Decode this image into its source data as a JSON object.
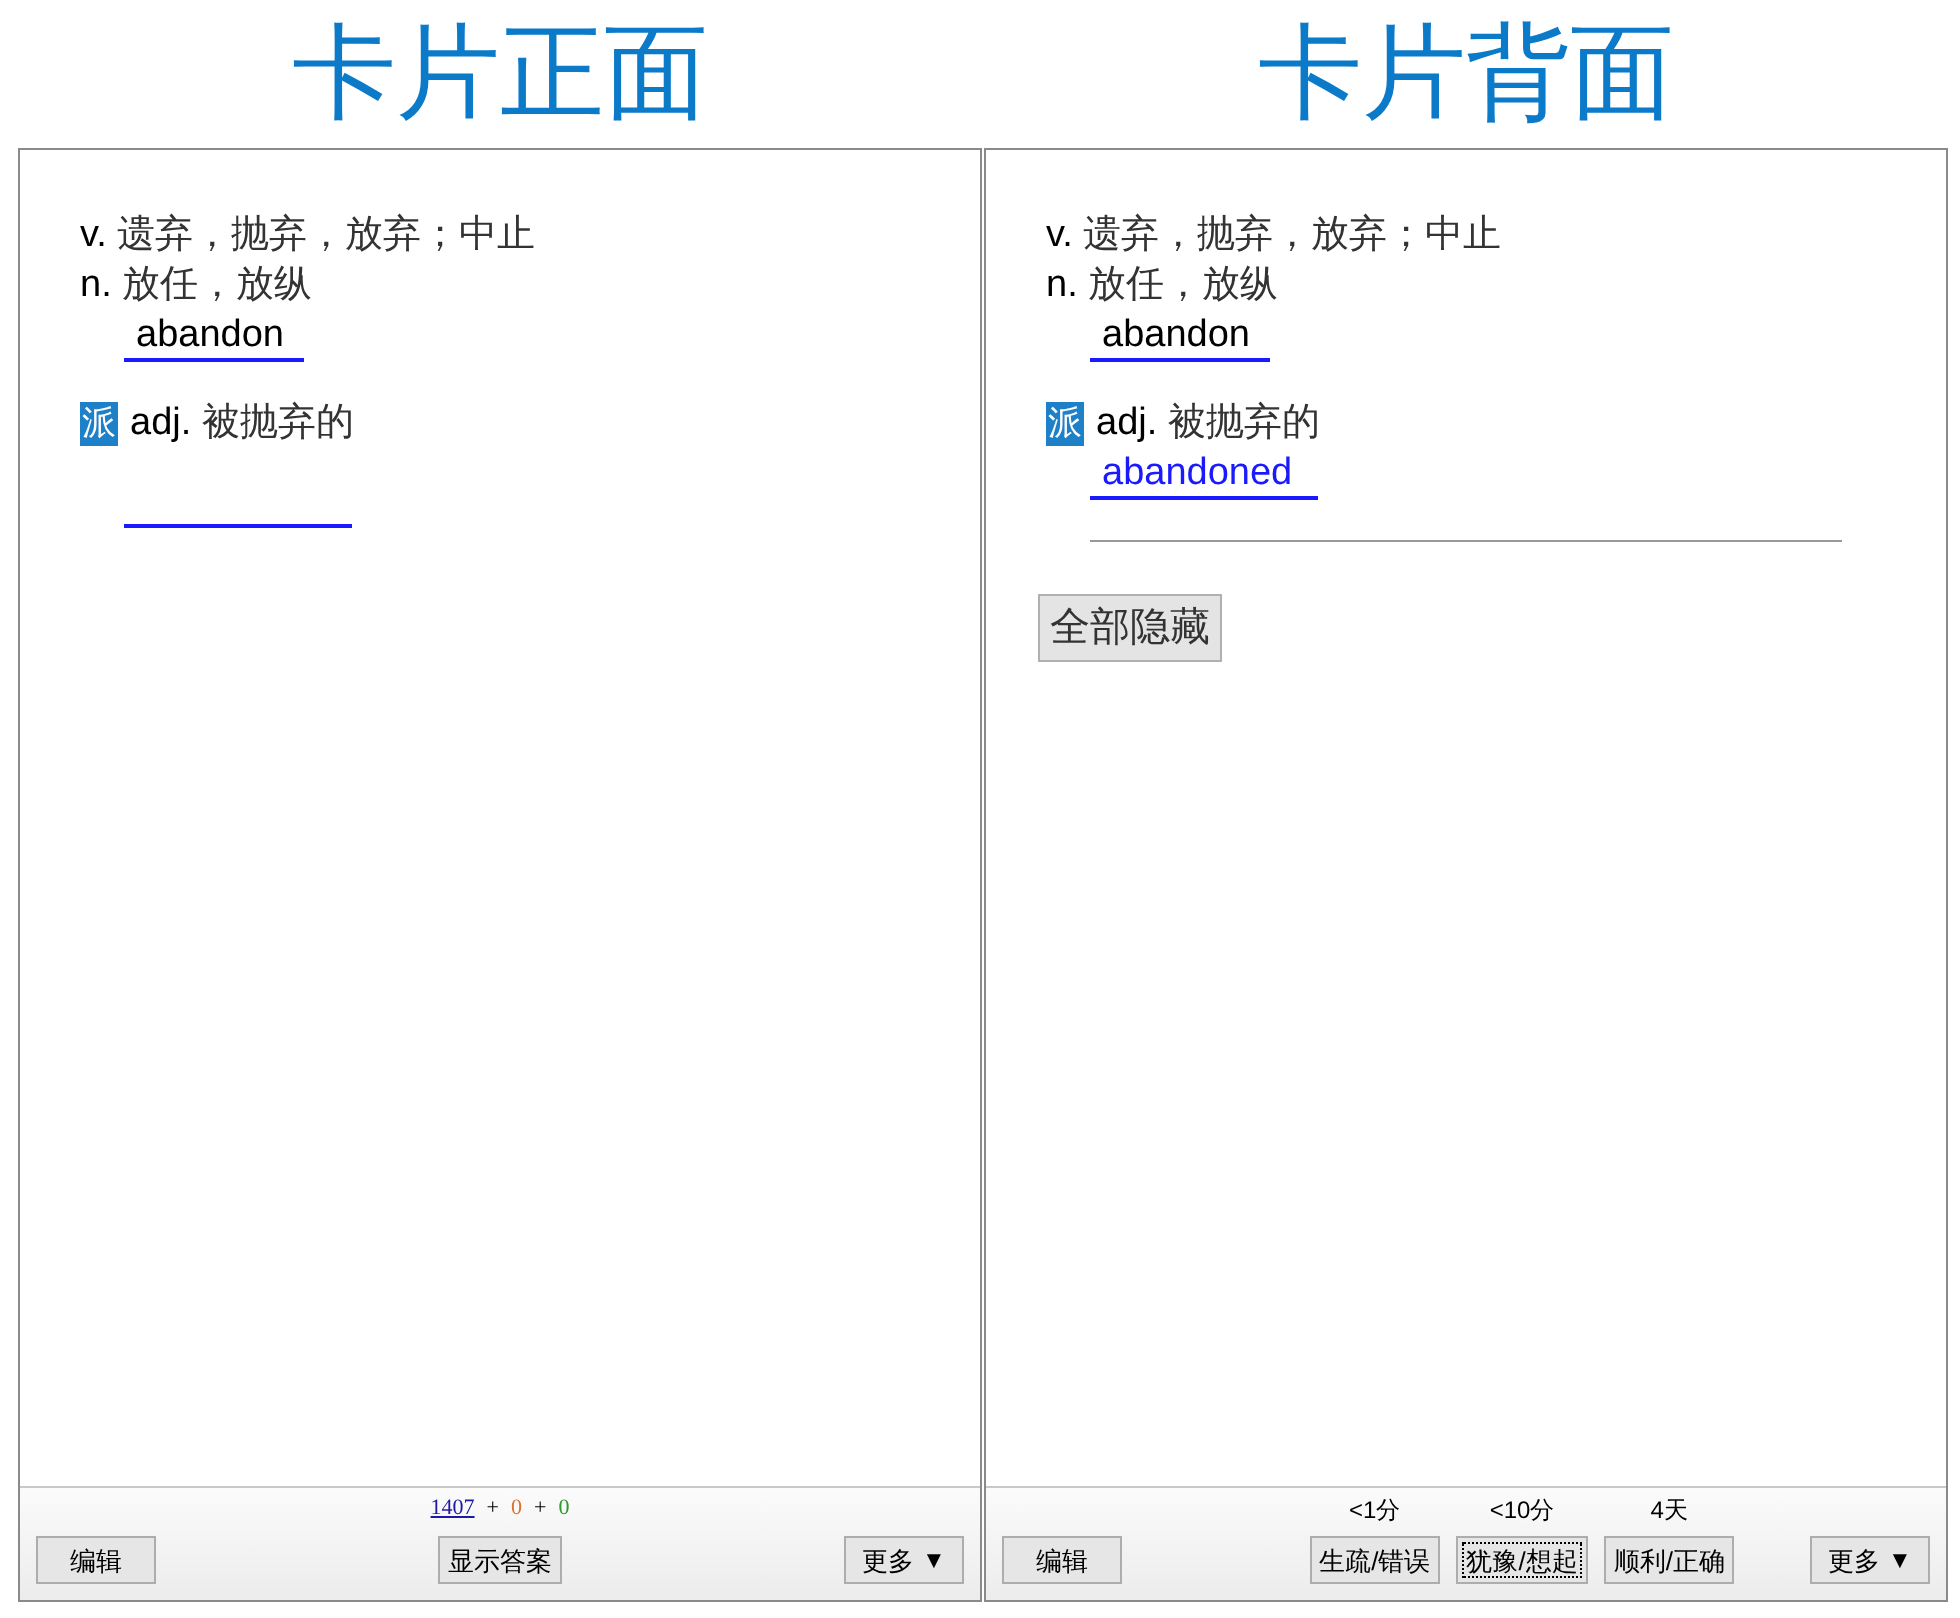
{
  "cards": [
    {
      "heading": "卡片正面",
      "senses": [
        {
          "pos": "v.",
          "meaning": "遗弃，抛弃，放弃；中止"
        },
        {
          "pos": "n.",
          "meaning": "放任，放纵"
        }
      ],
      "word": "abandon",
      "derived": {
        "tag": "派",
        "pos": "adj.",
        "meaning": "被抛弃的"
      },
      "footer": {
        "kind": "front",
        "edit": "编辑",
        "counts": [
          {
            "value": "1407",
            "color": "#1a1aa6",
            "link": true
          },
          {
            "value": "0",
            "color": "#e07030",
            "link": false
          },
          {
            "value": "0",
            "color": "#2a9a2a",
            "link": false
          }
        ],
        "separator": "+",
        "main_button": "显示答案",
        "more": {
          "label": "更多",
          "arrow": "▼"
        }
      }
    },
    {
      "heading": "卡片背面",
      "senses": [
        {
          "pos": "v.",
          "meaning": "遗弃，抛弃，放弃；中止"
        },
        {
          "pos": "n.",
          "meaning": "放任，放纵"
        }
      ],
      "word": "abandon",
      "derived": {
        "tag": "派",
        "pos": "adj.",
        "meaning": "被抛弃的",
        "answer": "abandoned"
      },
      "hide_all": "全部隐藏",
      "footer": {
        "kind": "back",
        "edit": "编辑",
        "ease": [
          {
            "interval": "<1分",
            "label": "生疏/错误",
            "focused": false
          },
          {
            "interval": "<10分",
            "label": "犹豫/想起",
            "focused": true
          },
          {
            "interval": "4天",
            "label": "顺利/正确",
            "focused": false
          }
        ],
        "more": {
          "label": "更多",
          "arrow": "▼"
        }
      }
    }
  ]
}
